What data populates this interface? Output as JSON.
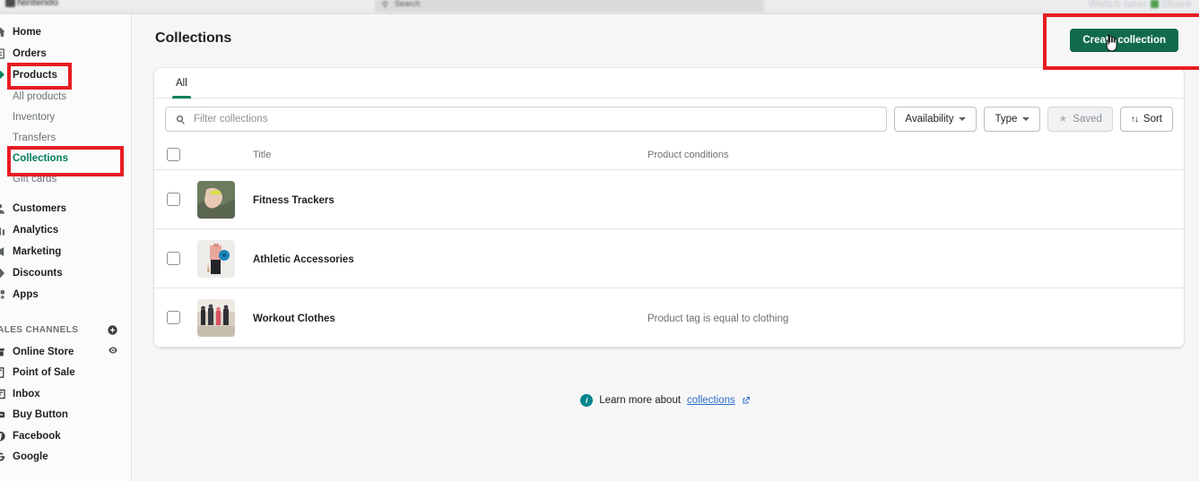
{
  "video_overlay": {
    "brand": "Nintendo",
    "search_placeholder": "Search",
    "right_controls": "Watch later",
    "share_label": "Share"
  },
  "sidebar": {
    "items": [
      {
        "label": "Home",
        "icon": "home-icon",
        "type": "nav"
      },
      {
        "label": "Orders",
        "icon": "orders-icon",
        "type": "nav"
      },
      {
        "label": "Products",
        "icon": "products-icon",
        "type": "nav"
      },
      {
        "label": "All products",
        "icon": "",
        "type": "sub"
      },
      {
        "label": "Inventory",
        "icon": "",
        "type": "sub"
      },
      {
        "label": "Transfers",
        "icon": "",
        "type": "sub"
      },
      {
        "label": "Collections",
        "icon": "",
        "type": "sub",
        "active": true
      },
      {
        "label": "Gift cards",
        "icon": "",
        "type": "sub"
      },
      {
        "label": "Customers",
        "icon": "customers-icon",
        "type": "nav"
      },
      {
        "label": "Analytics",
        "icon": "analytics-icon",
        "type": "nav"
      },
      {
        "label": "Marketing",
        "icon": "marketing-icon",
        "type": "nav"
      },
      {
        "label": "Discounts",
        "icon": "discounts-icon",
        "type": "nav"
      },
      {
        "label": "Apps",
        "icon": "apps-icon",
        "type": "nav"
      }
    ],
    "sales_channels": {
      "header": "SALES CHANNELS",
      "add_icon": "plus-circle-icon",
      "channels": [
        {
          "label": "Online Store",
          "icon": "online-store-icon",
          "trailing_icon": "eye-icon"
        },
        {
          "label": "Point of Sale",
          "icon": "point-of-sale-icon",
          "trailing_icon": ""
        },
        {
          "label": "Inbox",
          "icon": "inbox-icon",
          "trailing_icon": ""
        },
        {
          "label": "Buy Button",
          "icon": "buy-button-icon",
          "trailing_icon": ""
        },
        {
          "label": "Facebook",
          "icon": "facebook-icon",
          "trailing_icon": ""
        },
        {
          "label": "Google",
          "icon": "google-icon",
          "trailing_icon": ""
        }
      ]
    }
  },
  "header": {
    "title": "Collections",
    "create_button": "Create collection",
    "create_button_color": "#116b4b"
  },
  "tabs": [
    {
      "label": "All",
      "active": true
    }
  ],
  "filters": {
    "search_placeholder": "Filter collections",
    "search_value": "",
    "search_icon": "search-icon",
    "buttons": [
      {
        "label": "Availability",
        "type": "dropdown",
        "disabled": false
      },
      {
        "label": "Type",
        "type": "dropdown",
        "disabled": false
      },
      {
        "label": "Saved",
        "type": "star",
        "disabled": true
      },
      {
        "label": "Sort",
        "type": "sort",
        "disabled": false
      }
    ]
  },
  "table": {
    "columns": [
      "Title",
      "Product conditions"
    ],
    "rows": [
      {
        "title": "Fitness Trackers",
        "conditions": "",
        "thumb": "wrist-fitness-tracker-photo",
        "selected": false
      },
      {
        "title": "Athletic Accessories",
        "conditions": "",
        "thumb": "woman-yoga-mat-photo",
        "selected": false
      },
      {
        "title": "Workout Clothes",
        "conditions": "Product tag is equal to clothing",
        "thumb": "people-exercising-photo",
        "selected": false
      }
    ],
    "select_all": false
  },
  "footer": {
    "learn_prefix": "Learn more about",
    "learn_link": "collections",
    "info_icon": "info-icon",
    "external_icon": "external-link-icon"
  },
  "annotations": {
    "color": "#e81c23",
    "boxes": [
      "products-nav",
      "collections-nav",
      "create-collection-button"
    ]
  }
}
